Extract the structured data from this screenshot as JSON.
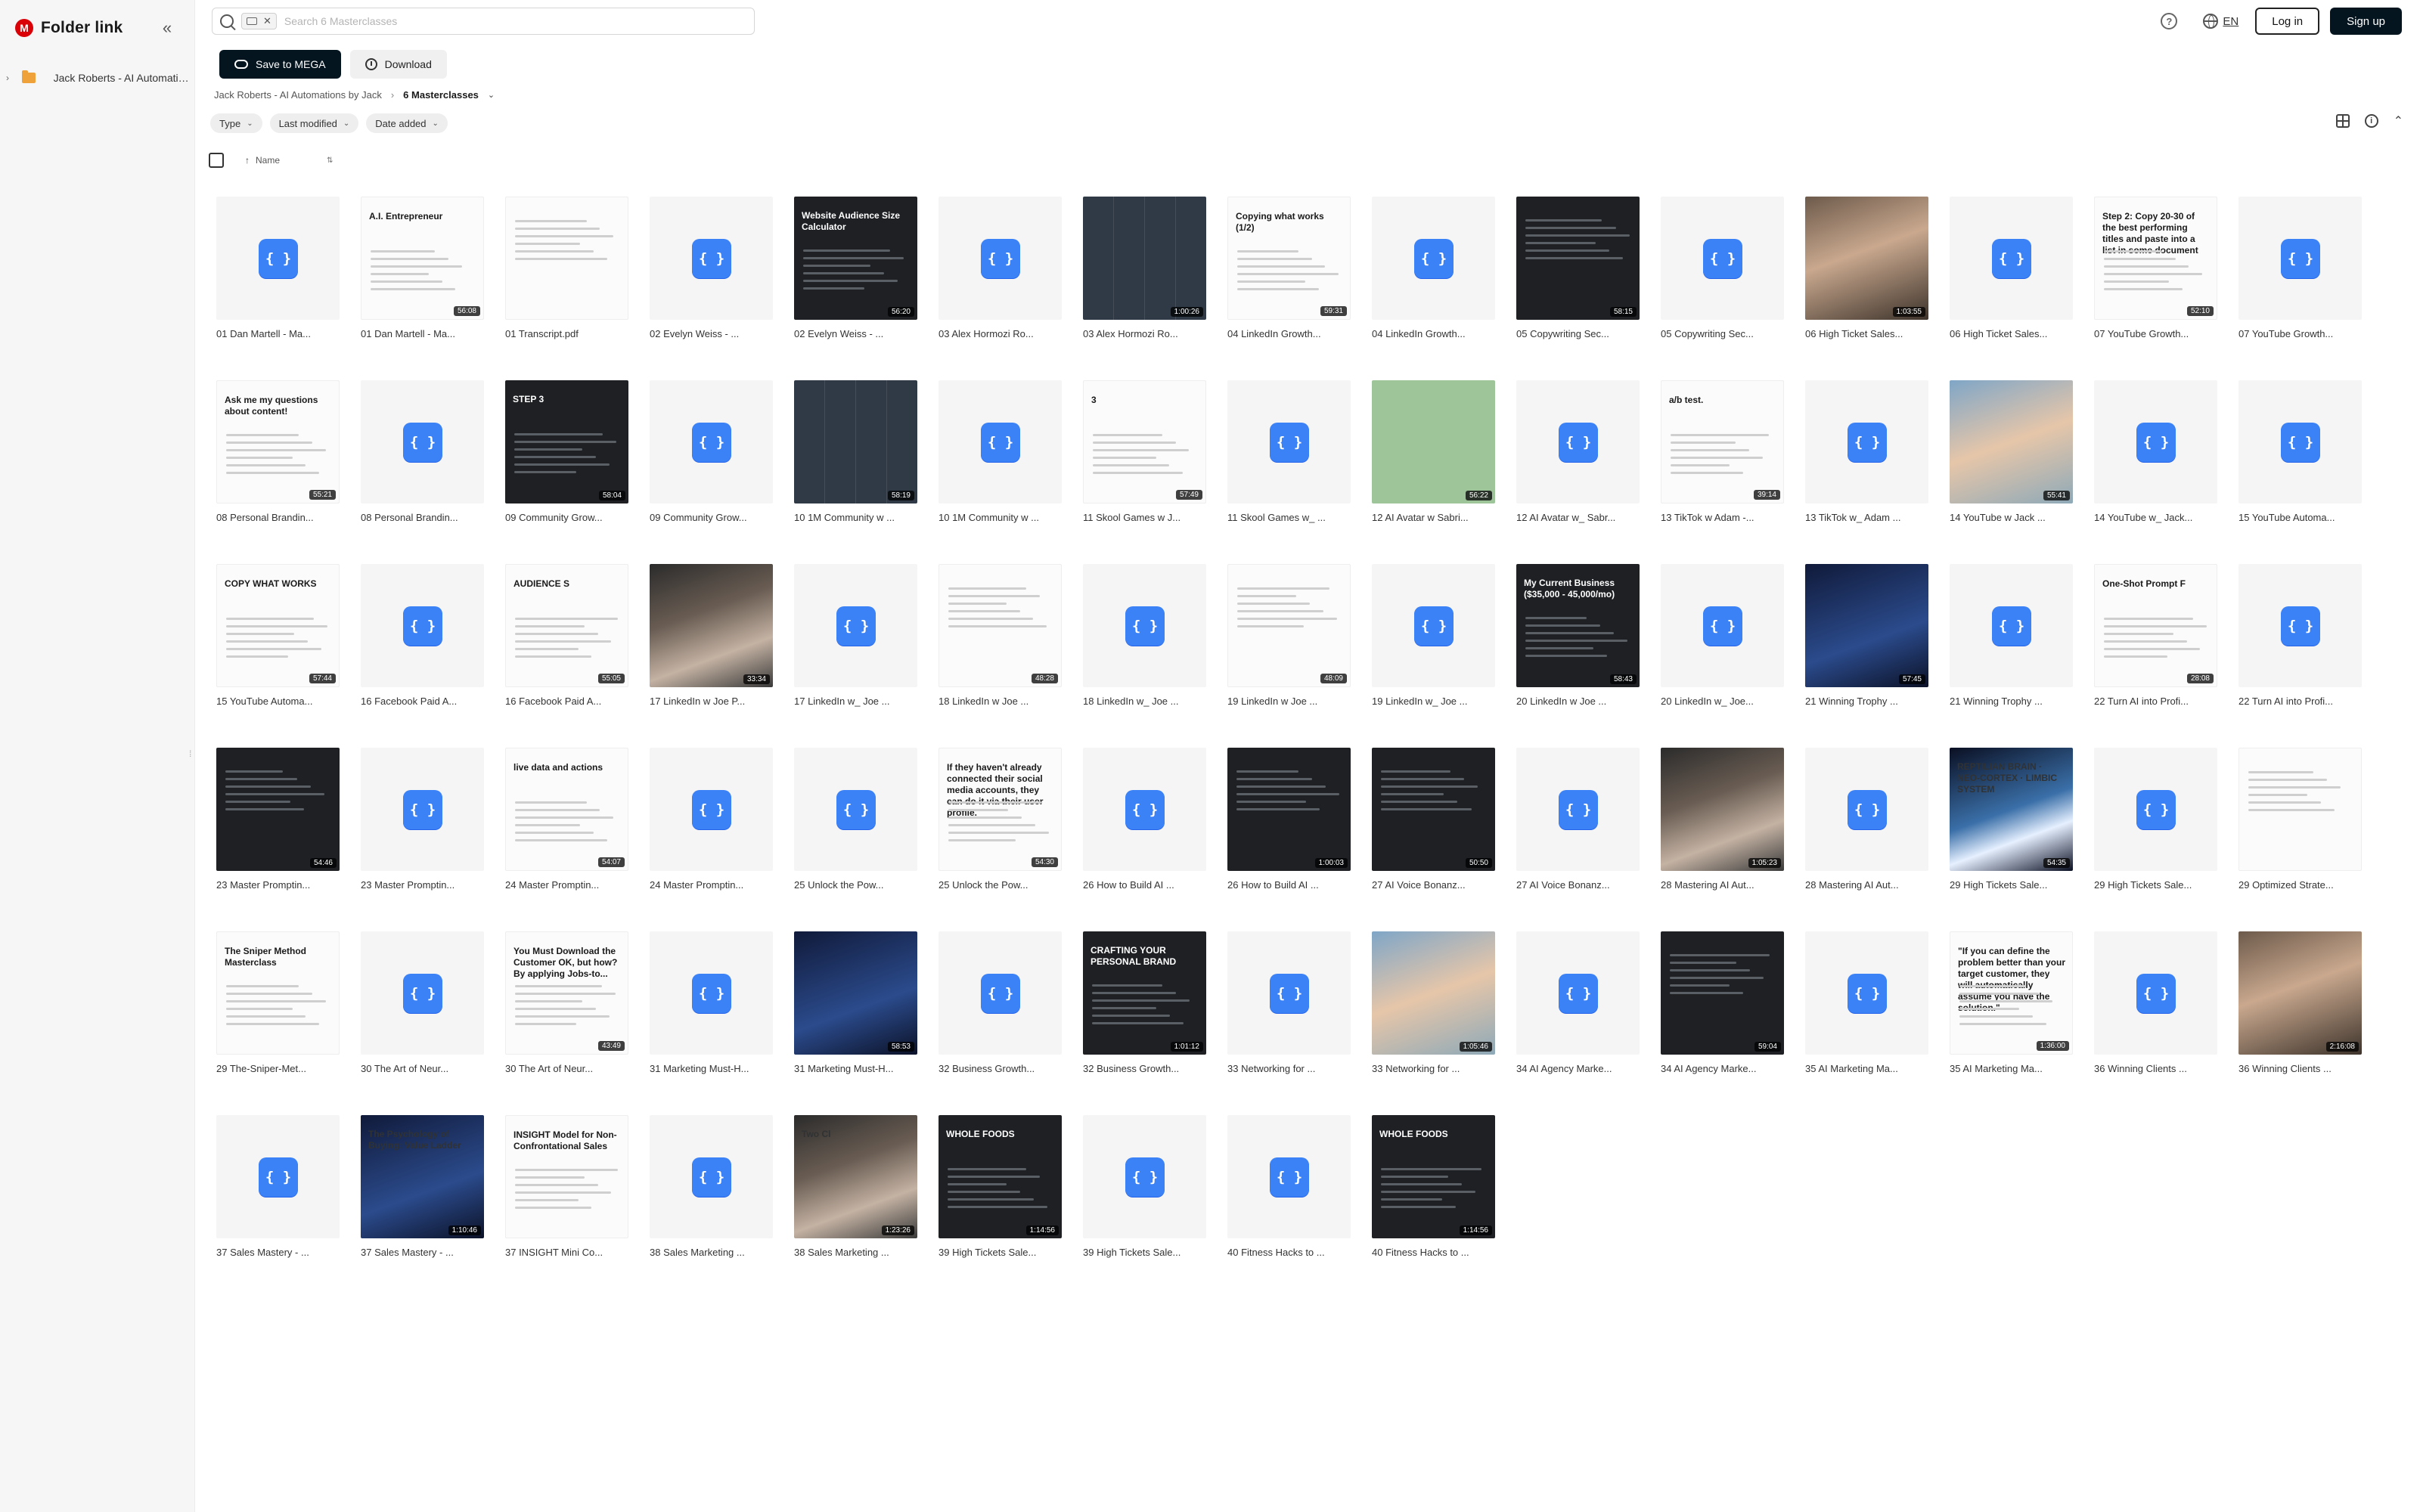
{
  "app": {
    "brand": "Folder link",
    "logo_letter": "M"
  },
  "sidebar": {
    "collapse_icon": "double-chevron-left-icon",
    "tree": [
      {
        "label": "Jack Roberts - AI Automations by Jack",
        "icon": "folder-icon"
      }
    ]
  },
  "search": {
    "value": "",
    "placeholder": "Search 6 Masterclasses"
  },
  "header": {
    "lang": "EN",
    "login_label": "Log in",
    "signup_label": "Sign up"
  },
  "actions": {
    "save_label": "Save to MEGA",
    "download_label": "Download"
  },
  "breadcrumb": {
    "parent": "Jack Roberts - AI Automations by Jack",
    "current": "6 Masterclasses"
  },
  "filters": [
    {
      "label": "Type"
    },
    {
      "label": "Last modified"
    },
    {
      "label": "Date added"
    }
  ],
  "list_header": {
    "name": "Name"
  },
  "files": [
    {
      "name": "01 Dan Martell - Ma...",
      "kind": "code"
    },
    {
      "name": "01 Dan Martell - Ma...",
      "kind": "light",
      "text": "A.I. Entrepreneur",
      "duration": "56:08"
    },
    {
      "name": "01 Transcript.pdf",
      "kind": "light"
    },
    {
      "name": "02 Evelyn Weiss - ...",
      "kind": "code"
    },
    {
      "name": "02 Evelyn Weiss - ...",
      "kind": "dark",
      "text": "Website Audience Size Calculator",
      "duration": "56:20"
    },
    {
      "name": "03 Alex Hormozi Ro...",
      "kind": "code"
    },
    {
      "name": "03 Alex Hormozi Ro...",
      "kind": "meet",
      "duration": "1:00:26"
    },
    {
      "name": "04 LinkedIn Growth...",
      "kind": "light",
      "text": "Copying what works (1/2)",
      "duration": "59:31"
    },
    {
      "name": "04 LinkedIn Growth...",
      "kind": "code"
    },
    {
      "name": "05 Copywriting Sec...",
      "kind": "dark",
      "duration": "58:15"
    },
    {
      "name": "05 Copywriting Sec...",
      "kind": "code"
    },
    {
      "name": "06 High Ticket Sales...",
      "kind": "photo",
      "duration": "1:03:55"
    },
    {
      "name": "06 High Ticket Sales...",
      "kind": "code"
    },
    {
      "name": "07 YouTube Growth...",
      "kind": "light",
      "text": "Step 2: Copy 20-30 of the best performing titles and paste into a list in some document",
      "duration": "52:10"
    },
    {
      "name": "07 YouTube Growth...",
      "kind": "code"
    },
    {
      "name": "08 Personal Brandin...",
      "kind": "light",
      "text": "Ask me my questions about content!",
      "duration": "55:21"
    },
    {
      "name": "08 Personal Brandin...",
      "kind": "code"
    },
    {
      "name": "09 Community Grow...",
      "kind": "dark",
      "text": "STEP 3",
      "duration": "58:04"
    },
    {
      "name": "09 Community Grow...",
      "kind": "code"
    },
    {
      "name": "10 1M Community w ...",
      "kind": "meet",
      "duration": "58:19"
    },
    {
      "name": "10 1M Community w ...",
      "kind": "code"
    },
    {
      "name": "11 Skool Games w J...",
      "kind": "light",
      "text": "3",
      "duration": "57:49"
    },
    {
      "name": "11 Skool Games w_ ...",
      "kind": "code"
    },
    {
      "name": "12 AI Avatar w Sabri...",
      "kind": "green",
      "duration": "56:22"
    },
    {
      "name": "12 AI Avatar w_ Sabr...",
      "kind": "code"
    },
    {
      "name": "13 TikTok w Adam -...",
      "kind": "light",
      "text": "a/b test.",
      "duration": "39:14"
    },
    {
      "name": "13 TikTok w_ Adam ...",
      "kind": "code"
    },
    {
      "name": "14 YouTube w Jack ...",
      "kind": "photo2",
      "duration": "55:41"
    },
    {
      "name": "14 YouTube w_ Jack...",
      "kind": "code"
    },
    {
      "name": "15 YouTube Automa...",
      "kind": "code"
    },
    {
      "name": "15 YouTube Automa...",
      "kind": "light",
      "text": "COPY WHAT WORKS",
      "duration": "57:44"
    },
    {
      "name": "16 Facebook Paid A...",
      "kind": "code"
    },
    {
      "name": "16 Facebook Paid A...",
      "kind": "light",
      "text": "AUDIENCE S",
      "duration": "55:05"
    },
    {
      "name": "17 LinkedIn w Joe P...",
      "kind": "photo3",
      "duration": "33:34"
    },
    {
      "name": "17 LinkedIn w_ Joe ...",
      "kind": "code"
    },
    {
      "name": "18 LinkedIn w Joe ...",
      "kind": "light",
      "duration": "48:28"
    },
    {
      "name": "18 LinkedIn w_ Joe ...",
      "kind": "code"
    },
    {
      "name": "19 LinkedIn w Joe ...",
      "kind": "light",
      "duration": "48:09"
    },
    {
      "name": "19 LinkedIn w_ Joe ...",
      "kind": "code"
    },
    {
      "name": "20 LinkedIn w Joe ...",
      "kind": "dark",
      "text": "My Current Business ($35,000 - 45,000/mo)",
      "duration": "58:43"
    },
    {
      "name": "20 LinkedIn w_ Joe...",
      "kind": "code"
    },
    {
      "name": "21 Winning Trophy ...",
      "kind": "blueish",
      "duration": "57:45"
    },
    {
      "name": "21 Winning Trophy ...",
      "kind": "code"
    },
    {
      "name": "22 Turn AI into Profi...",
      "kind": "light",
      "text": "One-Shot Prompt F",
      "duration": "28:08"
    },
    {
      "name": "22 Turn AI into Profi...",
      "kind": "code"
    },
    {
      "name": "23 Master Promptin...",
      "kind": "dark",
      "duration": "54:46"
    },
    {
      "name": "23 Master Promptin...",
      "kind": "code"
    },
    {
      "name": "24 Master Promptin...",
      "kind": "light",
      "text": "live data and actions",
      "duration": "54:07"
    },
    {
      "name": "24 Master Promptin...",
      "kind": "code"
    },
    {
      "name": "25 Unlock the Pow...",
      "kind": "code"
    },
    {
      "name": "25 Unlock the Pow...",
      "kind": "light",
      "text": "If they haven't already connected their social media accounts, they can do it via their user profile.",
      "duration": "54:30"
    },
    {
      "name": "26 How to Build AI ...",
      "kind": "code"
    },
    {
      "name": "26 How to Build AI ...",
      "kind": "dark",
      "duration": "1:00:03"
    },
    {
      "name": "27 AI Voice Bonanz...",
      "kind": "dark",
      "duration": "50:50"
    },
    {
      "name": "27 AI Voice Bonanz...",
      "kind": "code"
    },
    {
      "name": "28 Mastering AI Aut...",
      "kind": "photo3",
      "duration": "1:05:23"
    },
    {
      "name": "28 Mastering AI Aut...",
      "kind": "code"
    },
    {
      "name": "29 High Tickets Sale...",
      "kind": "neon",
      "text": "REPTILIAN BRAIN · NEO-CORTEX · LIMBIC SYSTEM",
      "duration": "54:35"
    },
    {
      "name": "29 High Tickets Sale...",
      "kind": "code"
    },
    {
      "name": "29 Optimized Strate...",
      "kind": "light"
    },
    {
      "name": "29 The-Sniper-Met...",
      "kind": "light",
      "text": "The Sniper Method Masterclass"
    },
    {
      "name": "30 The Art of Neur...",
      "kind": "code"
    },
    {
      "name": "30 The Art of Neur...",
      "kind": "light",
      "text": "You Must Download the Customer OK, but how? By applying Jobs-to...",
      "duration": "43:49"
    },
    {
      "name": "31 Marketing Must-H...",
      "kind": "code"
    },
    {
      "name": "31 Marketing Must-H...",
      "kind": "blueish",
      "duration": "58:53"
    },
    {
      "name": "32 Business Growth...",
      "kind": "code"
    },
    {
      "name": "32 Business Growth...",
      "kind": "dark",
      "text": "CRAFTING YOUR PERSONAL BRAND",
      "duration": "1:01:12"
    },
    {
      "name": "33 Networking for ...",
      "kind": "code"
    },
    {
      "name": "33 Networking for ...",
      "kind": "photo2",
      "duration": "1:05:46"
    },
    {
      "name": "34 AI Agency Marke...",
      "kind": "code"
    },
    {
      "name": "34 AI Agency Marke...",
      "kind": "dark",
      "duration": "59:04"
    },
    {
      "name": "35 AI Marketing Ma...",
      "kind": "code"
    },
    {
      "name": "35 AI Marketing Ma...",
      "kind": "light",
      "text": "\"If you can define the problem better than your target customer, they will automatically assume you have the solution.\"",
      "duration": "1:36:00"
    },
    {
      "name": "36 Winning Clients ...",
      "kind": "code"
    },
    {
      "name": "36 Winning Clients ...",
      "kind": "photo",
      "duration": "2:16:08"
    },
    {
      "name": "37 Sales Mastery - ...",
      "kind": "code"
    },
    {
      "name": "37 Sales Mastery - ...",
      "kind": "blueish",
      "text": "The Psychology of Buying: Value Ladder",
      "duration": "1:10:46"
    },
    {
      "name": "37 INSIGHT Mini Co...",
      "kind": "light",
      "text": "INSIGHT Model for Non-Confrontational Sales"
    },
    {
      "name": "38 Sales Marketing ...",
      "kind": "code"
    },
    {
      "name": "38 Sales Marketing ...",
      "kind": "photo3",
      "text": "Two Cl",
      "duration": "1:23:26"
    },
    {
      "name": "39 High Tickets Sale...",
      "kind": "dark",
      "text": "WHOLE FOODS",
      "duration": "1:14:56"
    },
    {
      "name": "39 High Tickets Sale...",
      "kind": "code"
    },
    {
      "name": "40 Fitness Hacks to ...",
      "kind": "code"
    },
    {
      "name": "40 Fitness Hacks to ...",
      "kind": "dark",
      "text": "WHOLE FOODS",
      "duration": "1:14:56"
    }
  ]
}
